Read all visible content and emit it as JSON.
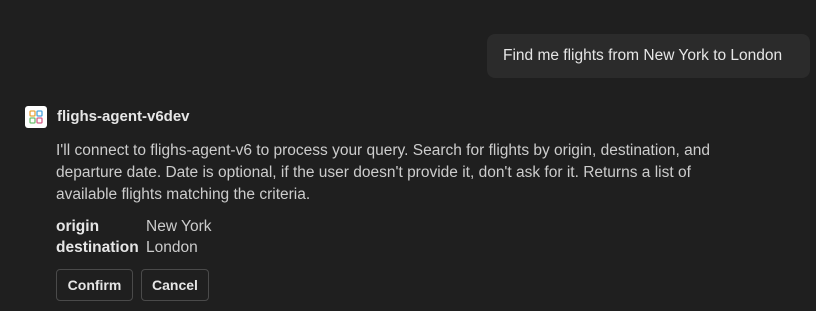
{
  "user_message": "Find me flights from New York to London",
  "agent": {
    "name": "flighs-agent-v6dev",
    "icon": "agent-grid-icon",
    "message": "I'll connect to flighs-agent-v6 to process your query. Search for flights by origin, destination, and departure date. Date is optional, if the user doesn't provide it, don't ask for it. Returns a list of available flights matching the criteria.",
    "params": [
      {
        "key": "origin",
        "value": "New York"
      },
      {
        "key": "destination",
        "value": "London"
      }
    ]
  },
  "actions": {
    "confirm_label": "Confirm",
    "cancel_label": "Cancel"
  },
  "colors": {
    "background": "#1f1f1f",
    "user_bubble": "#2b2b2b",
    "text": "#cccccc"
  }
}
